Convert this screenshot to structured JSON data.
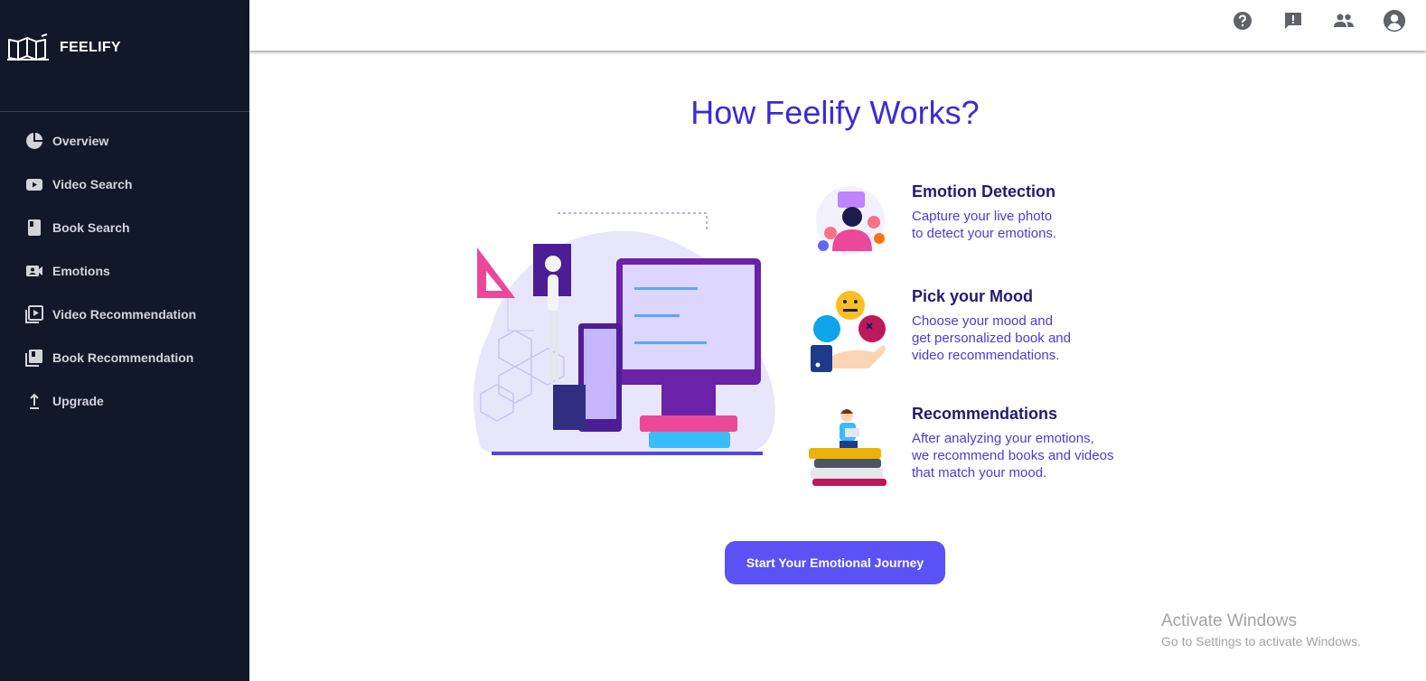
{
  "sidebar": {
    "brand": "FEELIFY",
    "items": [
      {
        "label": "Overview",
        "icon": "pie-chart-icon"
      },
      {
        "label": "Video Search",
        "icon": "video-icon"
      },
      {
        "label": "Book Search",
        "icon": "book-icon"
      },
      {
        "label": "Emotions",
        "icon": "camera-icon"
      },
      {
        "label": "Video Recommendation",
        "icon": "video-library-icon"
      },
      {
        "label": "Book Recommendation",
        "icon": "book-library-icon"
      },
      {
        "label": "Upgrade",
        "icon": "upload-icon"
      }
    ]
  },
  "topbar": {
    "icons": [
      "help-icon",
      "feedback-icon",
      "group-icon",
      "account-icon"
    ]
  },
  "main": {
    "title": "How Feelify Works?",
    "features": [
      {
        "heading": "Emotion Detection",
        "lines": [
          "Capture your live photo",
          "to detect your emotions."
        ]
      },
      {
        "heading": "Pick your Mood",
        "lines": [
          "Choose your mood and",
          "get personalized book and",
          "video recommendations."
        ]
      },
      {
        "heading": "Recommendations",
        "lines": [
          "After analyzing your emotions,",
          "we recommend books and videos",
          "that match your mood."
        ]
      }
    ],
    "cta": "Start Your Emotional Journey"
  },
  "watermark": {
    "line1": "Activate Windows",
    "line2": "Go to Settings to activate Windows."
  },
  "colors": {
    "sidebar_bg": "#111827",
    "title": "#3b2bd6",
    "heading": "#231a74",
    "body_text": "#4c3bd6",
    "button": "#5b52f5"
  }
}
